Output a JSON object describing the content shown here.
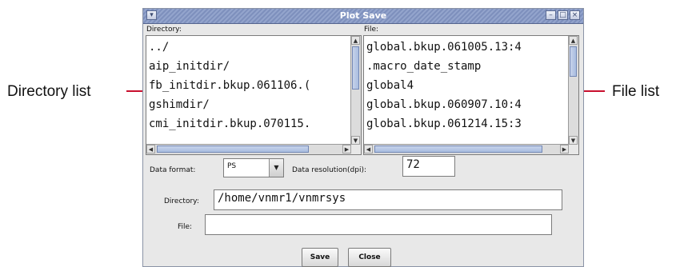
{
  "annotations": {
    "directory_list": "Directory list",
    "file_list": "File list"
  },
  "window": {
    "title": "Plot Save",
    "menu_glyph": "▾",
    "controls": {
      "minimize": "–",
      "maximize": "□",
      "close": "×"
    }
  },
  "directory": {
    "label": "Directory:",
    "items": [
      "../",
      "aip_initdir/",
      "fb_initdir.bkup.061106.(",
      "gshimdir/",
      "cmi_initdir.bkup.070115."
    ]
  },
  "file": {
    "label": "File:",
    "items": [
      "global.bkup.061005.13:4",
      ".macro_date_stamp",
      "global4",
      "global.bkup.060907.10:4",
      "global.bkup.061214.15:3"
    ]
  },
  "scroll_glyphs": {
    "up": "▲",
    "down": "▼",
    "left": "◀",
    "right": "▶"
  },
  "data_format": {
    "label": "Data format:",
    "value": "PS",
    "arrow": "▼"
  },
  "data_resolution": {
    "label": "Data resolution(dpi):",
    "value": "72"
  },
  "directory_field": {
    "label": "Directory:",
    "value": "/home/vnmr1/vnmrsys"
  },
  "file_field": {
    "label": "File:",
    "value": ""
  },
  "buttons": {
    "save": "Save",
    "close": "Close"
  },
  "colors": {
    "callout_line": "#c8102e",
    "titlebar": "#8a9cc6",
    "window_bg": "#e8e8e8"
  }
}
